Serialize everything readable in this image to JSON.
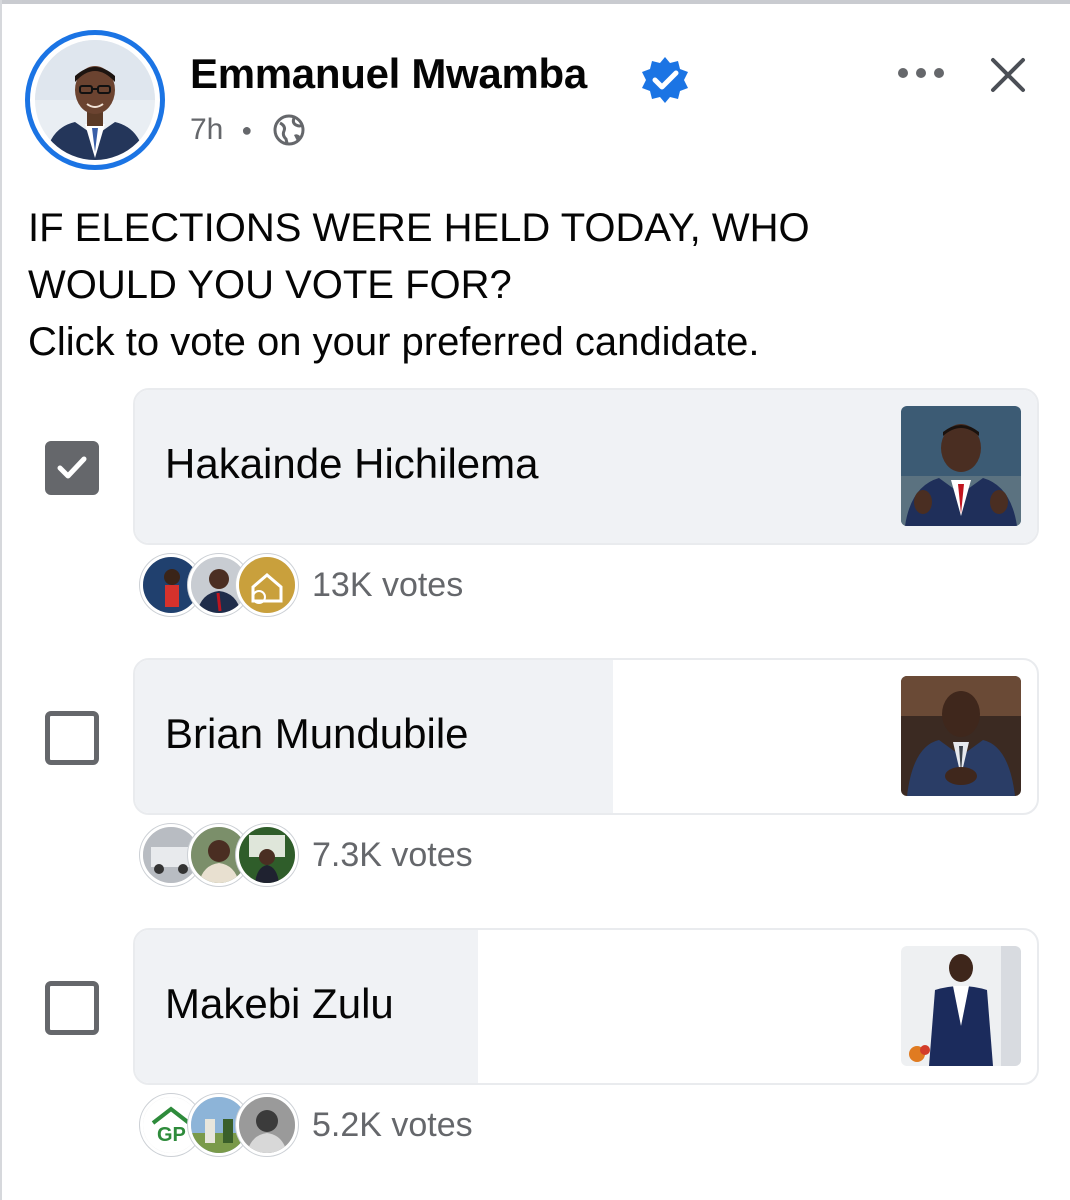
{
  "post": {
    "author": "Emmanuel Mwamba",
    "time": "7h",
    "privacy_icon": "globe-icon",
    "verified_icon": "verified-badge-icon",
    "text_lines": [
      "IF ELECTIONS WERE HELD TODAY, WHO",
      "WOULD YOU VOTE FOR?",
      "Click to vote on your preferred candidate."
    ]
  },
  "header_actions": {
    "more_icon": "more-options-icon",
    "close_icon": "close-icon"
  },
  "poll": {
    "options": [
      {
        "label": "Hakainde Hichilema",
        "checked": true,
        "votes": "13K votes",
        "share": 1.0
      },
      {
        "label": "Brian Mundubile",
        "checked": false,
        "votes": "7.3K votes",
        "share": 0.53
      },
      {
        "label": "Makebi Zulu",
        "checked": false,
        "votes": "5.2K votes",
        "share": 0.38
      }
    ]
  },
  "colors": {
    "accent": "#1b74e4",
    "checkbox": "#65676b",
    "bar": "#f0f2f5",
    "secondary_text": "#65676b"
  }
}
